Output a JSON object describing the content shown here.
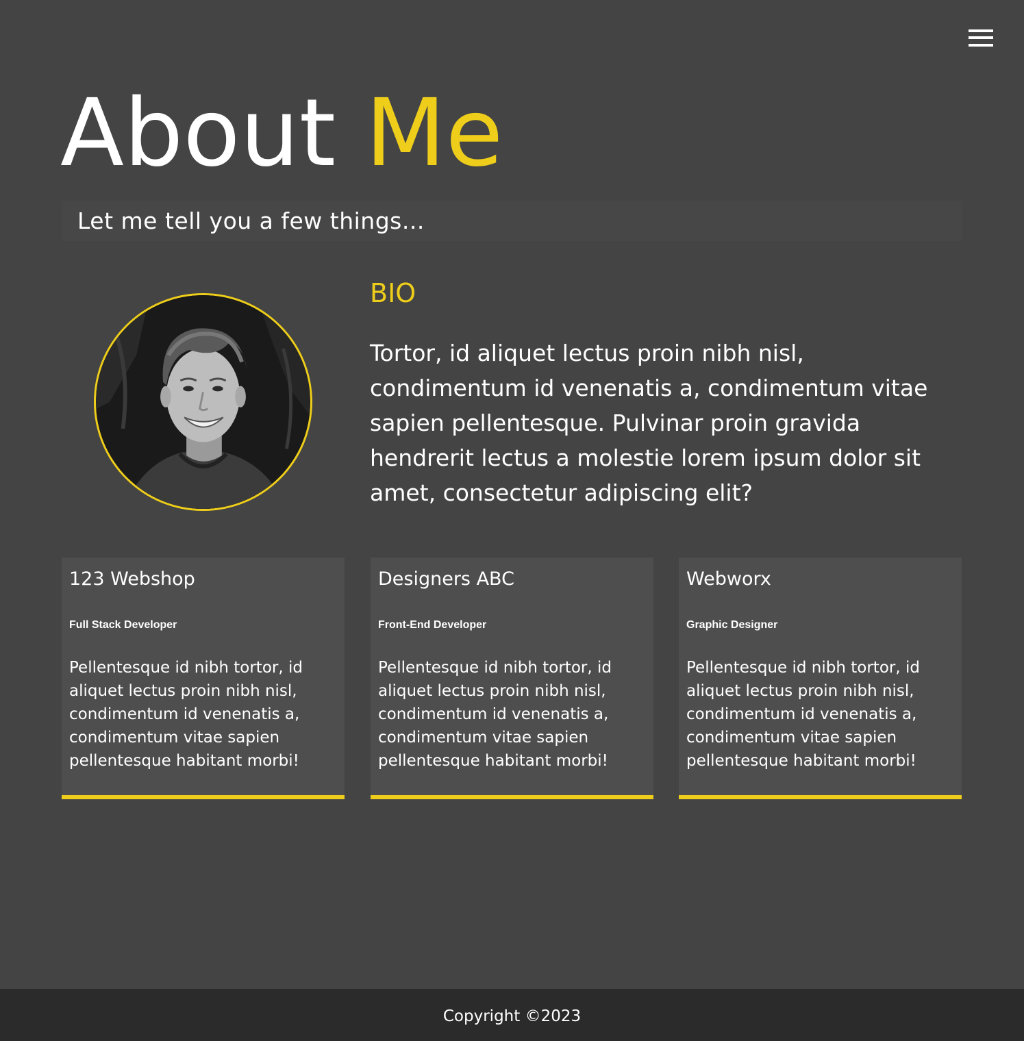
{
  "header": {
    "menu_icon": "hamburger-menu-icon"
  },
  "hero": {
    "title_main": "About",
    "title_accent": "Me",
    "subtitle": "Let me tell you a few things..."
  },
  "bio": {
    "heading": "BIO",
    "text": "Tortor, id aliquet lectus proin nibh nisl, condimentum id venenatis a, condimentum vitae sapien pellentesque. Pulvinar proin gravida hendrerit lectus a molestie lorem ipsum dolor sit amet, consectetur adipiscing elit?"
  },
  "experience": [
    {
      "company": "123 Webshop",
      "role": "Full Stack Developer",
      "description": "Pellentesque id nibh tortor, id aliquet lectus proin nibh nisl, condimentum id venenatis a, condimentum vitae sapien pellentesque habitant morbi!"
    },
    {
      "company": "Designers ABC",
      "role": "Front-End Developer",
      "description": "Pellentesque id nibh tortor, id aliquet lectus proin nibh nisl, condimentum id venenatis a, condimentum vitae sapien pellentesque habitant morbi!"
    },
    {
      "company": "Webworx",
      "role": "Graphic Designer",
      "description": "Pellentesque id nibh tortor, id aliquet lectus proin nibh nisl, condimentum id venenatis a, condimentum vitae sapien pellentesque habitant morbi!"
    }
  ],
  "footer": {
    "copyright": "Copyright ©2023"
  },
  "colors": {
    "background": "#444444",
    "accent": "#eece1a",
    "card": "#4e4e4e",
    "footer": "#2b2b2b"
  }
}
